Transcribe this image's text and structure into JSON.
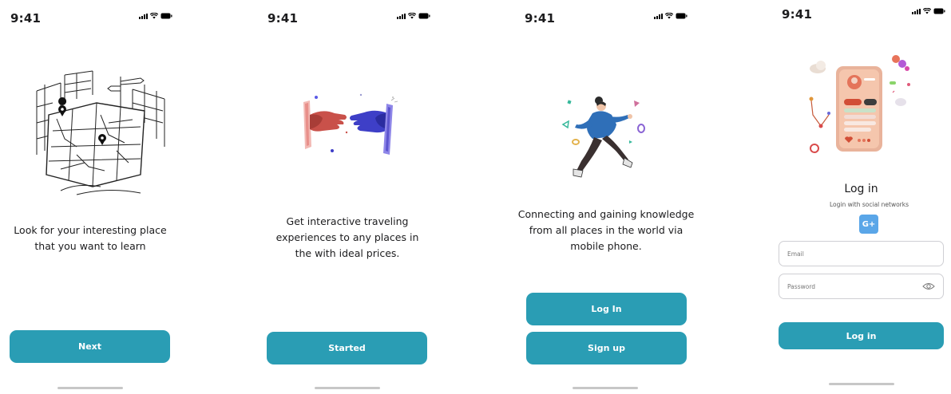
{
  "status": {
    "time": "9:41"
  },
  "screens": [
    {
      "caption_lines": [
        "Look for your interesting place",
        "that you want to learn"
      ],
      "button": "Next",
      "illustration": "city-map-illustration"
    },
    {
      "caption_lines": [
        "Get interactive traveling",
        "experiences to any places in",
        "the with ideal prices."
      ],
      "button": "Started",
      "illustration": "handshake-phones-illustration"
    },
    {
      "caption_lines": [
        "Connecting and gaining knowledge",
        "from all places in the world via",
        "mobile phone."
      ],
      "buttons": [
        "Log In",
        "Sign up"
      ],
      "illustration": "running-woman-illustration"
    },
    {
      "title": "Log in",
      "subtitle": "Login with social networks",
      "social_icon": "G+",
      "email_placeholder": "Email",
      "password_placeholder": "Password",
      "button": "Log in",
      "illustration": "phone-profile-illustration"
    }
  ],
  "colors": {
    "primary": "#2a9db4",
    "text": "#1c1c1e",
    "home_bar": "#c7c7c7",
    "field_border": "#cfcfd4"
  },
  "icons": [
    "signal-icon",
    "wifi-icon",
    "battery-icon",
    "eye-icon",
    "google-plus-icon"
  ]
}
